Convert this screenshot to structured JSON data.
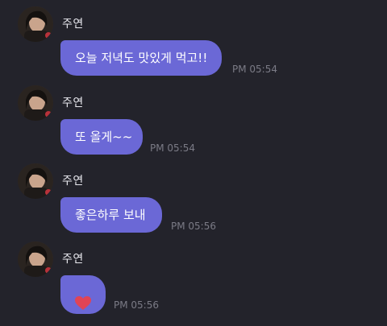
{
  "messages": [
    {
      "sender": "주연",
      "text": "오늘 저녁도 맛있게 먹고!!",
      "time": "PM 05:54"
    },
    {
      "sender": "주연",
      "text": "또 올게~~",
      "time": "PM 05:54"
    },
    {
      "sender": "주연",
      "text": "좋은하루 보내",
      "time": "PM 05:56"
    },
    {
      "sender": "주연",
      "icon": "heart-icon",
      "time": "PM 05:56"
    }
  ],
  "colors": {
    "background": "#23232b",
    "bubble": "#6b68d6",
    "heart": "#e04456",
    "timestamp": "#7b7b86"
  }
}
